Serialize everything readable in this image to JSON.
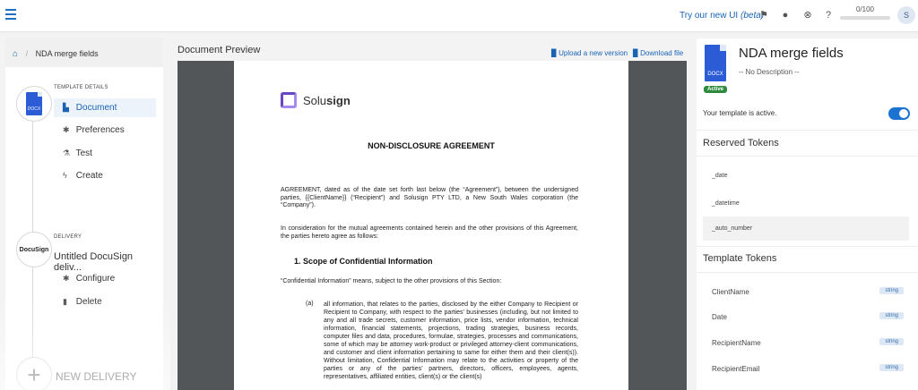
{
  "topbar": {
    "try_text": "Try our new UI",
    "try_beta": "(beta)",
    "usage_text": "0/100",
    "usage_fraction": 0.0,
    "avatar_initial": "S",
    "accent_color": "#1a73d0"
  },
  "left": {
    "breadcrumb": "NDA merge fields",
    "template_details_label": "TEMPLATE DETAILS",
    "docx_label": "DOCX",
    "nav": [
      {
        "label": "Document",
        "icon": "file-icon"
      },
      {
        "label": "Preferences",
        "icon": "gear-icon"
      },
      {
        "label": "Test",
        "icon": "flask-icon"
      },
      {
        "label": "Create",
        "icon": "bolt-icon"
      }
    ],
    "delivery_label": "DELIVERY",
    "docusign_logo": "DocuSign",
    "delivery_title": "Untitled DocuSign deliv...",
    "delivery_nav": [
      {
        "label": "Configure",
        "icon": "gear-icon"
      },
      {
        "label": "Delete",
        "icon": "trash-icon"
      }
    ],
    "new_delivery": "NEW DELIVERY"
  },
  "center": {
    "title": "Document Preview",
    "upload_label": "Upload a new version",
    "download_label": "Download file",
    "document": {
      "logo_prefix": "Solu",
      "logo_suffix": "sign",
      "heading": "NON-DISCLOSURE AGREEMENT",
      "para1": "AGREEMENT, dated as of the date set forth last below (the “Agreement”), between the undersigned parties, {{ClientName}} (“Recipient”) and Solusign PTY LTD, a New South Wales corporation (the “Company”).",
      "para2": "In consideration for the mutual agreements contained herein and the other provisions of this Agreement, the parties hereto agree as follows:",
      "section_heading": "1.  Scope of Confidential Information",
      "para3": "“Confidential Information” means, subject to the other provisions of this Section:",
      "item_a_label": "(a)",
      "item_a": "all information, that relates to the parties, disclosed by the either Company to Recipient or Recipient to Company, with respect to the parties’ businesses (including, but not limited to any and all trade secrets, customer information, price lists, vendor information, technical information, financial statements, projections, trading strategies, business records, computer files and data, procedures, formulae, strategies, processes and communications, some of which may be attorney work-product or privileged attorney-client communications, and customer and client information pertaining to same for either them and their client(s)). Without limitation, Confidential Information may relate to the activities or property of the parties or any of the parties’ partners, directors, officers, employees, agents, representatives, affiliated entities, client(s) or the client(s)"
    }
  },
  "right": {
    "docx_label": "DOCX",
    "status_badge": "Active",
    "template_name": "NDA merge fields",
    "description": "-- No Description --",
    "active_text": "Your template is active.",
    "reserved_heading": "Reserved Tokens",
    "reserved_tokens": [
      "_date",
      "_datetime",
      "_auto_number"
    ],
    "template_heading": "Template Tokens",
    "template_tokens": [
      {
        "name": "ClientName",
        "type": "string"
      },
      {
        "name": "Date",
        "type": "string"
      },
      {
        "name": "RecipientName",
        "type": "string"
      },
      {
        "name": "RecipientEmail",
        "type": "string"
      }
    ]
  }
}
